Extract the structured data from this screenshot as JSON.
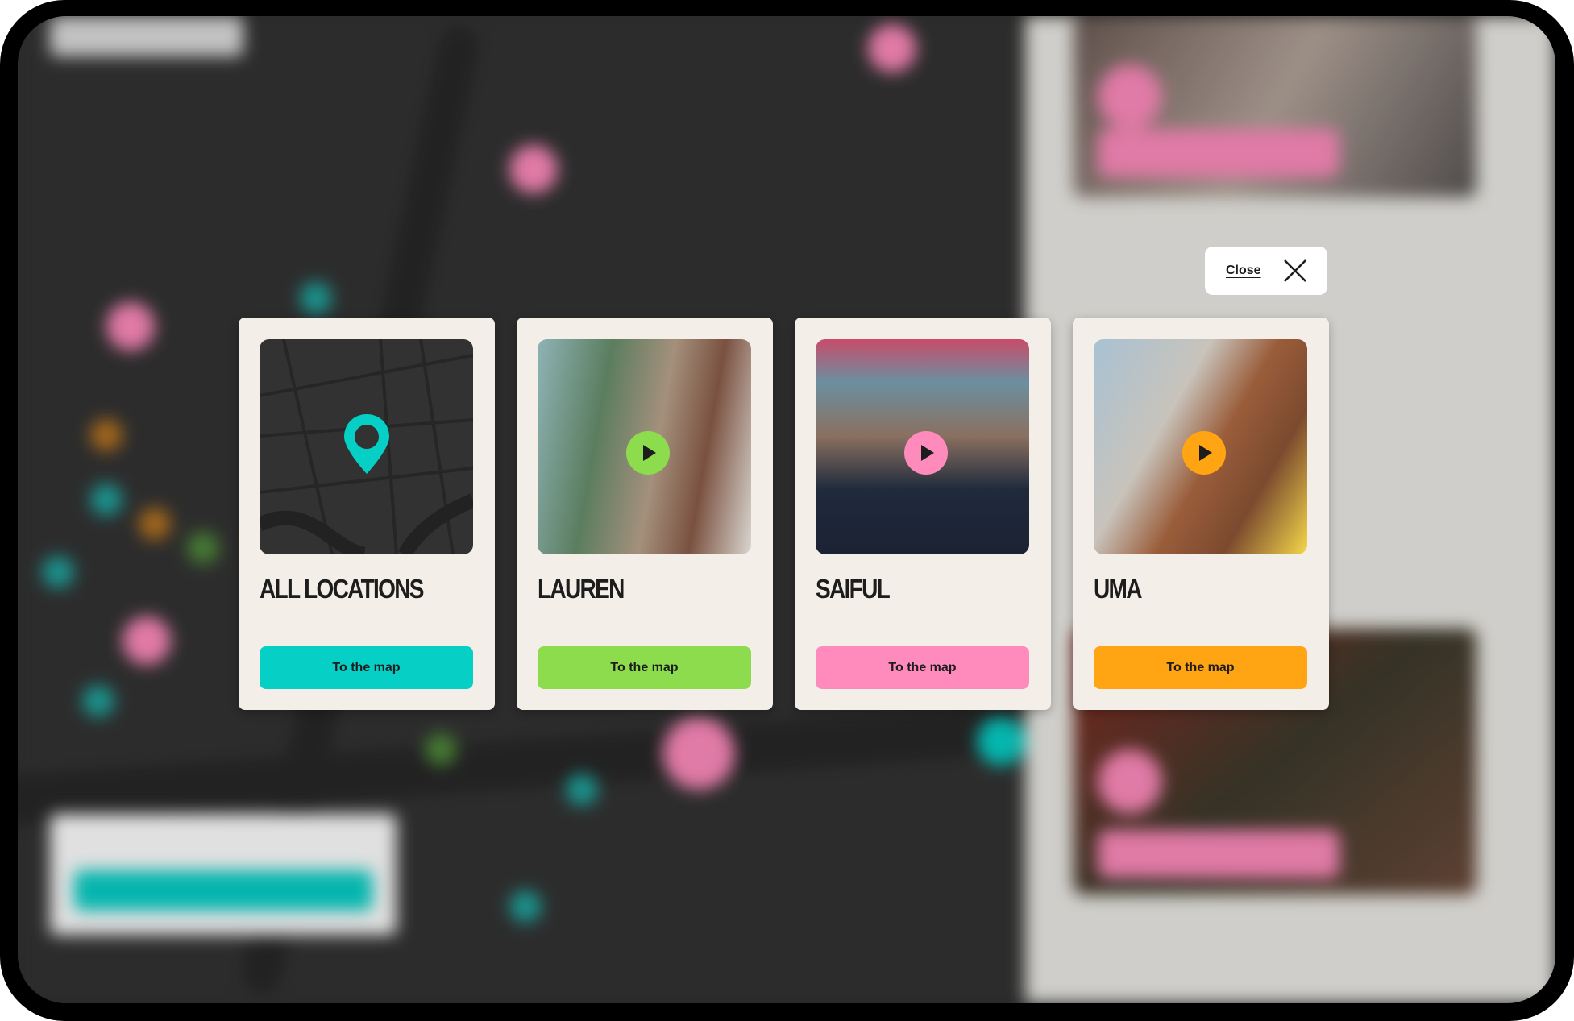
{
  "close_label": "Close",
  "cards": [
    {
      "title": "ALL LOCATIONS",
      "button": "To the map",
      "color": "#06cfc6",
      "image": "map-with-pin"
    },
    {
      "title": "LAUREN",
      "button": "To the map",
      "color": "#8ddc4e",
      "image": "photo-lauren"
    },
    {
      "title": "SAIFUL",
      "button": "To the map",
      "color": "#ff8bbd",
      "image": "photo-saiful"
    },
    {
      "title": "UMA",
      "button": "To the map",
      "color": "#ffa412",
      "image": "photo-uma"
    }
  ]
}
